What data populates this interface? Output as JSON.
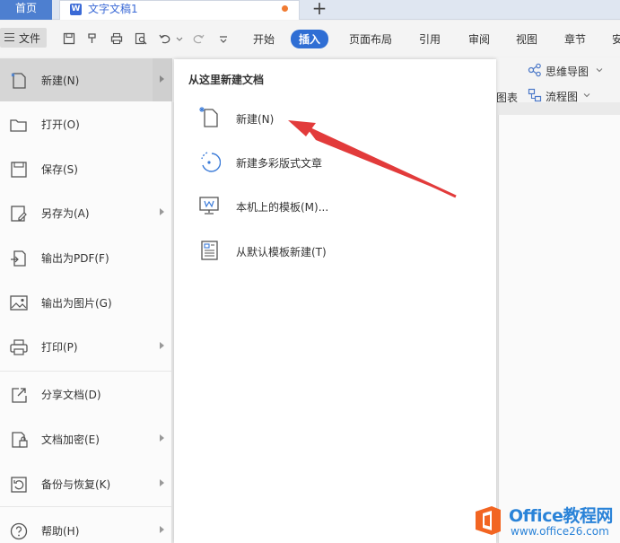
{
  "titlebar": {
    "home_tab": "首页",
    "doc_tab": "文字文稿1",
    "new_tab": "+"
  },
  "ribbon": {
    "file_label": "文件",
    "tabs": [
      "开始",
      "插入",
      "页面布局",
      "引用",
      "审阅",
      "视图",
      "章节",
      "安"
    ],
    "active_tab": "插入",
    "tools": {
      "mindmap": "思维导图",
      "chart_partial": "图表",
      "flowchart": "流程图"
    }
  },
  "file_menu": {
    "items": [
      {
        "label": "新建(N)",
        "icon": "new-file-icon",
        "submenu": true
      },
      {
        "label": "打开(O)",
        "icon": "folder-open-icon",
        "submenu": false
      },
      {
        "label": "保存(S)",
        "icon": "save-icon",
        "submenu": false
      },
      {
        "label": "另存为(A)",
        "icon": "save-as-icon",
        "submenu": true
      },
      {
        "label": "输出为PDF(F)",
        "icon": "pdf-export-icon",
        "submenu": false
      },
      {
        "label": "输出为图片(G)",
        "icon": "image-export-icon",
        "submenu": false
      },
      {
        "label": "打印(P)",
        "icon": "print-icon",
        "submenu": true
      },
      {
        "label": "分享文档(D)",
        "icon": "share-icon",
        "submenu": false
      },
      {
        "label": "文档加密(E)",
        "icon": "encrypt-icon",
        "submenu": true
      },
      {
        "label": "备份与恢复(K)",
        "icon": "backup-icon",
        "submenu": true
      },
      {
        "label": "帮助(H)",
        "icon": "help-icon",
        "submenu": true
      }
    ]
  },
  "submenu": {
    "title": "从这里新建文档",
    "items": [
      {
        "label": "新建(N)",
        "icon": "blank-doc-icon"
      },
      {
        "label": "新建多彩版式文章",
        "icon": "colorful-article-icon"
      },
      {
        "label": "本机上的模板(M)...",
        "icon": "local-template-icon"
      },
      {
        "label": "从默认模板新建(T)",
        "icon": "default-template-icon"
      }
    ]
  },
  "watermark": {
    "brand": "Office教程网",
    "site": "www.office26.com"
  },
  "colors": {
    "accent_blue": "#2f6ed4",
    "home_tab": "#4d7fd0",
    "arrow_red": "#e23b3b",
    "watermark_orange": "#f26522"
  }
}
